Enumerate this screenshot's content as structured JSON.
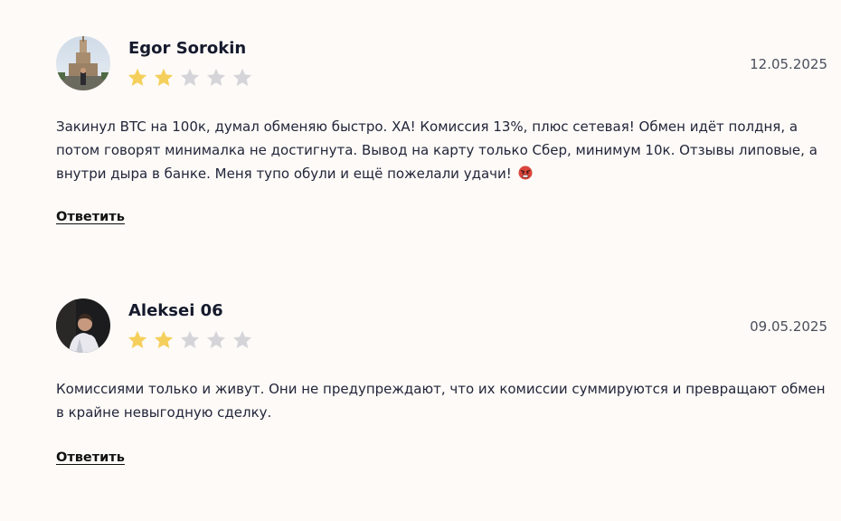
{
  "reviews": [
    {
      "author": "Egor Sorokin",
      "avatar": "building-photo-avatar",
      "rating": 2,
      "max_rating": 5,
      "date": "12.05.2025",
      "text": "Закинул BTC на 100к, думал обменяю быстро. ХА! Комиссия 13%, плюс сетевая! Обмен идёт полдня, а потом говорят минималка не достигнута. Вывод на карту только Сбер, минимум 10к. Отзывы липовые, а внутри дыра в банке. Меня тупо обули и ещё пожелали удачи!",
      "emoji": "angry-face-emoji",
      "reply_label": "Ответить"
    },
    {
      "author": "Aleksei 06",
      "avatar": "person-photo-avatar",
      "rating": 2,
      "max_rating": 5,
      "date": "09.05.2025",
      "text": "Комиссиями только и живут. Они не предупреждают, что их комиссии суммируются и превращают обмен в крайне невыгодную сделку.",
      "reply_label": "Ответить"
    }
  ],
  "colors": {
    "background": "#fdfaf7",
    "star_filled": "#f5cf5b",
    "star_empty": "#d5d5d9",
    "text": "#22263a"
  }
}
